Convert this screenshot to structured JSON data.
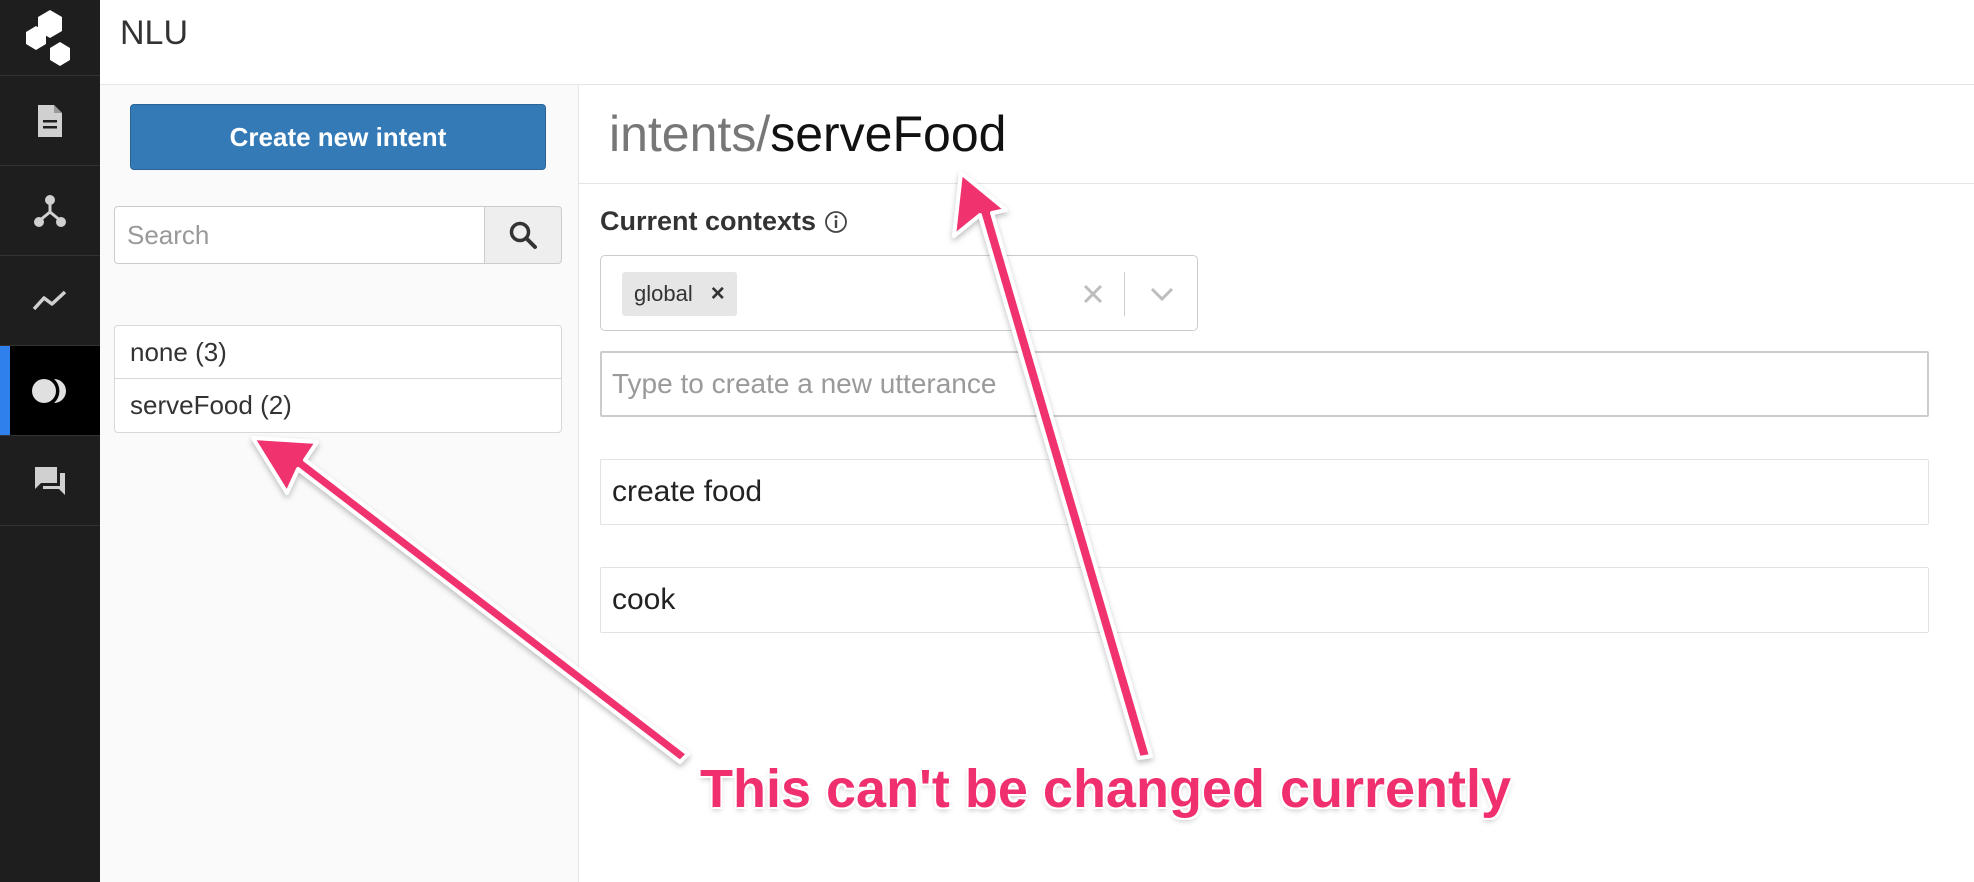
{
  "header": {
    "title": "NLU"
  },
  "rail": {
    "items": [
      {
        "icon": "document-icon"
      },
      {
        "icon": "flow-icon"
      },
      {
        "icon": "analytics-icon"
      },
      {
        "icon": "nlu-icon",
        "active": true
      },
      {
        "icon": "chat-icon"
      }
    ],
    "accent": "#2f80ed"
  },
  "sidebar": {
    "create_label": "Create new intent",
    "search_placeholder": "Search",
    "intents": [
      {
        "label": "none (3)"
      },
      {
        "label": "serveFood (2)"
      }
    ]
  },
  "main": {
    "title_prefix": "intents/",
    "title_name": "serveFood",
    "contexts_label": "Current contexts",
    "contexts": [
      {
        "label": "global",
        "remove": "×"
      }
    ],
    "utterance_placeholder": "Type to create a new utterance",
    "utterances": [
      {
        "text": "create food"
      },
      {
        "text": "cook"
      }
    ]
  },
  "annotation": {
    "text": "This can't be changed currently",
    "color": "#f0306e"
  },
  "colors": {
    "primary": "#337ab7",
    "rail_bg": "#1e1e1e"
  }
}
